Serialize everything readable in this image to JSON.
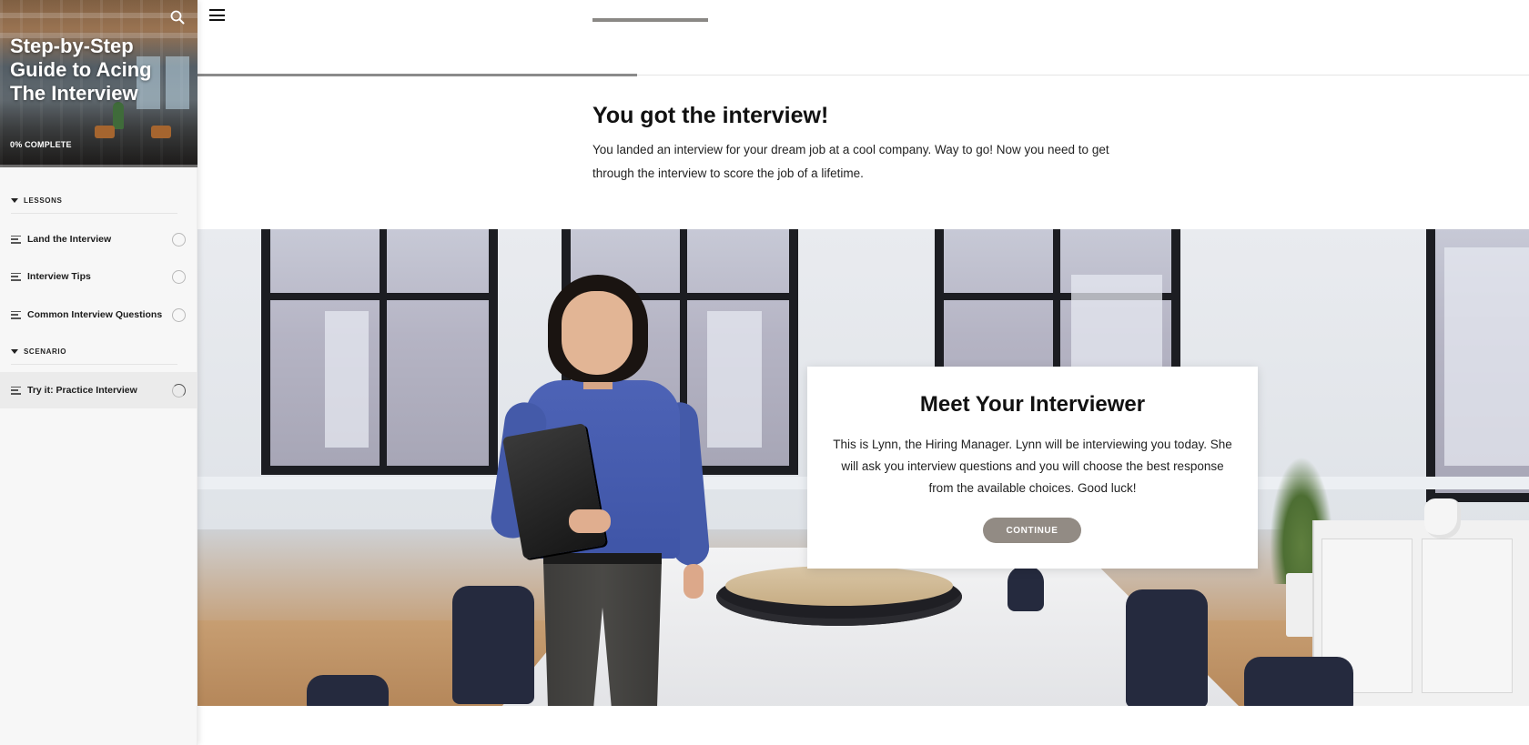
{
  "sidebar": {
    "course_title": "Step-by-Step Guide to Acing The Interview",
    "progress_label": "0% COMPLETE",
    "progress_fraction": 0,
    "sections": [
      {
        "heading": "LESSONS",
        "items": [
          {
            "label": "Land the Interview",
            "status": "not-started"
          },
          {
            "label": "Interview Tips",
            "status": "not-started"
          },
          {
            "label": "Common Interview Questions",
            "status": "not-started"
          }
        ]
      },
      {
        "heading": "SCENARIO",
        "items": [
          {
            "label": "Try it: Practice Interview",
            "status": "in-progress",
            "active": true
          }
        ]
      }
    ]
  },
  "header": {
    "menu_icon": "hamburger-menu-icon",
    "search_icon": "search-icon",
    "lesson_progress_fraction": 0.33
  },
  "intro": {
    "title": "You got the interview!",
    "body": "You landed an interview for your dream job at a cool company. Way to go! Now you need to get through the interview to score the job of a lifetime."
  },
  "scenario": {
    "card_title": "Meet Your Interviewer",
    "card_body": "This is Lynn, the Hiring Manager. Lynn will be interviewing you today. She will ask you interview questions and you will choose the best response from the available choices. Good luck!",
    "continue_label": "CONTINUE"
  },
  "colors": {
    "accent": "#928b84",
    "progress": "#8a8a8a",
    "sidebar_bg": "#f7f7f7"
  }
}
